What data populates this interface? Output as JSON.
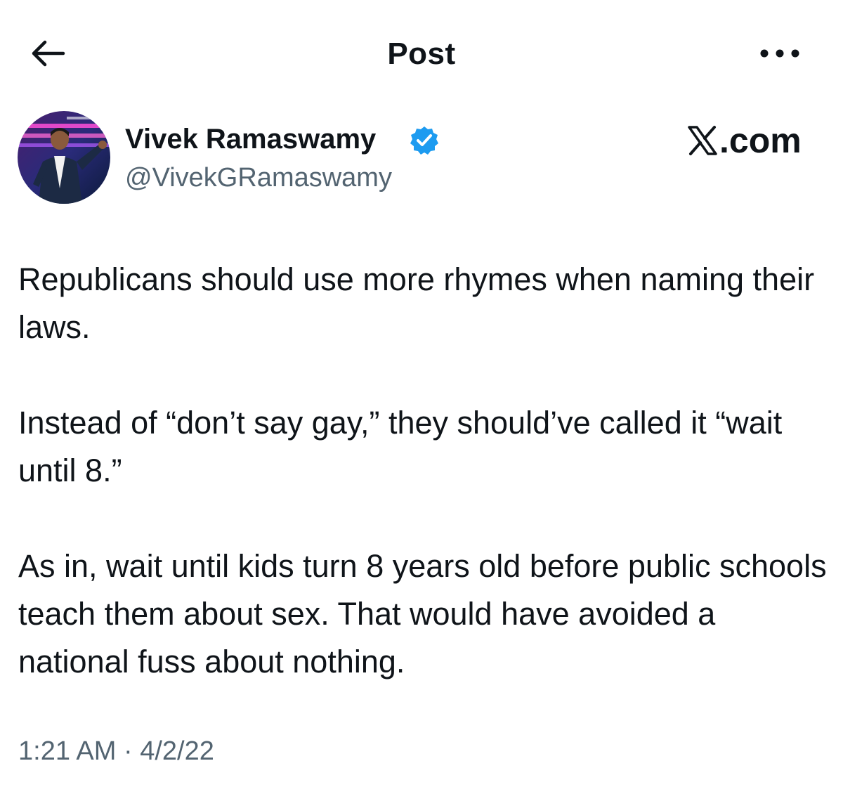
{
  "header": {
    "title": "Post",
    "back_icon": "arrow-left-icon",
    "more_icon": "ellipsis-horizontal-icon"
  },
  "author": {
    "display_name": "Vivek Ramaswamy",
    "handle": "@VivekGRamaswamy",
    "verified": true,
    "verified_color": "#1d9bf0"
  },
  "brand": {
    "text": ".com",
    "icon": "x-logo-icon"
  },
  "post": {
    "paragraphs": [
      "Republicans should use more rhymes when naming their laws.",
      "Instead of “don’t say gay,” they should’ve called it “wait until 8.”",
      "As in, wait until kids turn 8 years old before public schools teach them about sex. That would have avoided a national fuss about nothing."
    ],
    "time": "1:21 AM",
    "separator": "·",
    "date": "4/2/22"
  },
  "colors": {
    "text_primary": "#0f1419",
    "text_secondary": "#536471",
    "background": "#ffffff"
  }
}
